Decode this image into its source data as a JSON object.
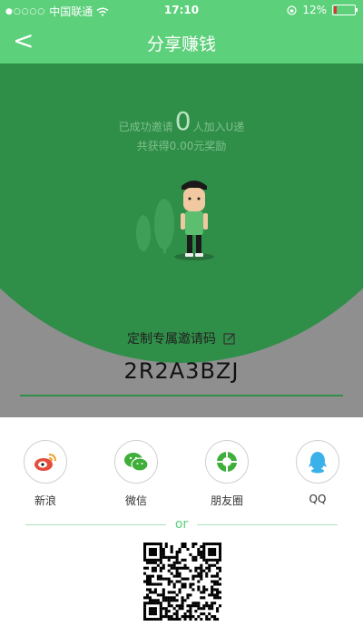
{
  "statusbar": {
    "carrier": "中国联通",
    "time": "17:10",
    "battery": "12%",
    "battery_fraction": 0.12
  },
  "navbar": {
    "back_icon": "<",
    "title": "分享赚钱"
  },
  "stats": {
    "prefix": "已成功邀请",
    "count": "0",
    "suffix": "人加入U递",
    "earned": "共获得0.00元奖励"
  },
  "invite": {
    "label": "定制专属邀请码",
    "code": "2R2A3BZJ"
  },
  "share": {
    "items": [
      {
        "label": "新浪",
        "icon": "weibo-icon",
        "color": "#e34b3b"
      },
      {
        "label": "微信",
        "icon": "wechat-icon",
        "color": "#3fae3a"
      },
      {
        "label": "朋友圈",
        "icon": "moments-icon",
        "color": "#3fae3a"
      },
      {
        "label": "QQ",
        "icon": "qq-icon",
        "color": "#3ab1e8"
      }
    ],
    "divider": "or"
  },
  "colors": {
    "accent": "#5cd07a",
    "hero": "#2f8e48"
  }
}
